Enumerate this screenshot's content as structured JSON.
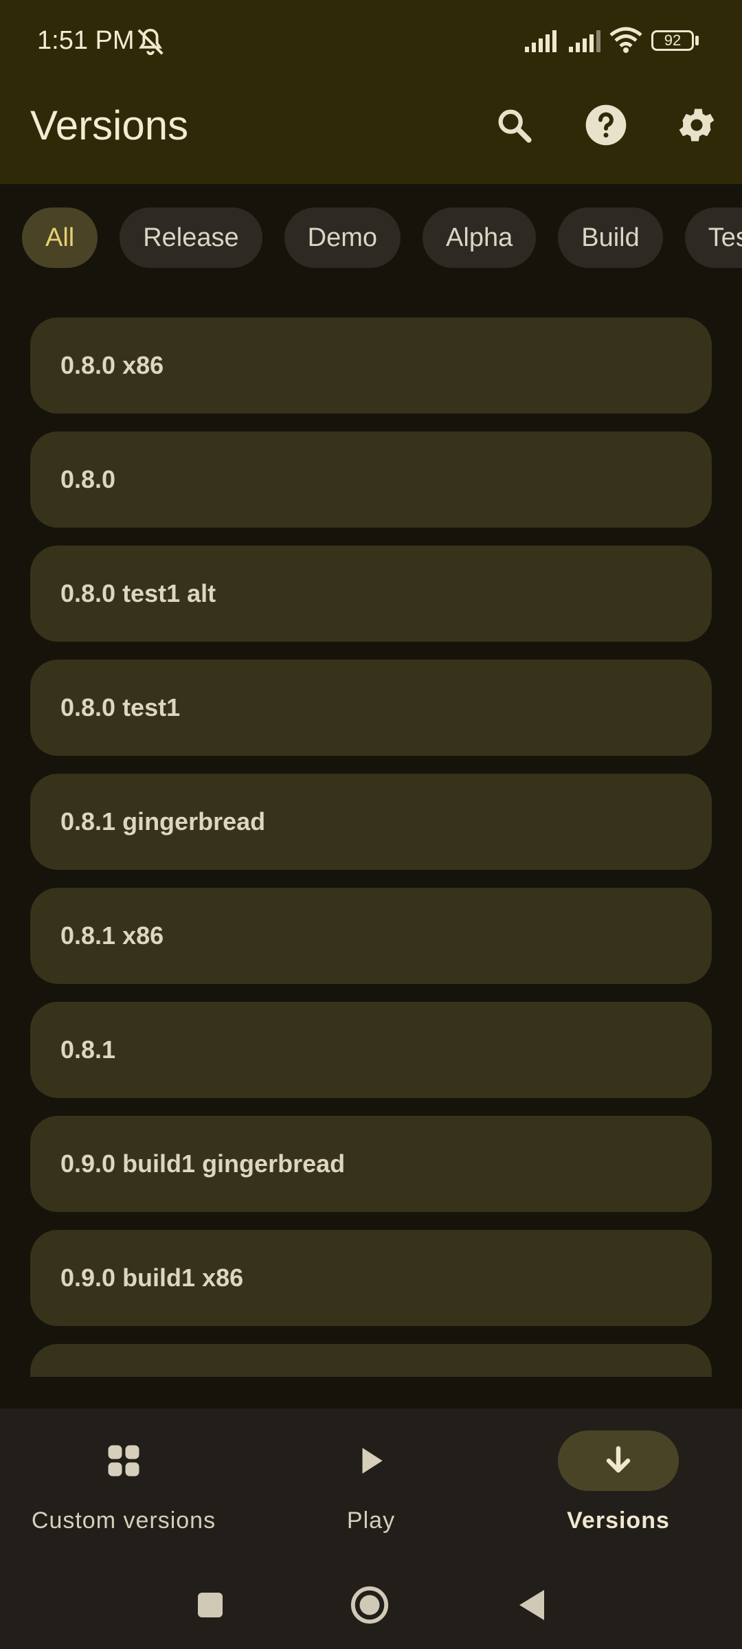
{
  "status_bar": {
    "time": "1:51 PM",
    "battery": "92"
  },
  "app_bar": {
    "title": "Versions",
    "icons": [
      "search-icon",
      "help-icon",
      "settings-icon"
    ]
  },
  "filters": {
    "selected": "All",
    "chips": [
      "All",
      "Release",
      "Demo",
      "Alpha",
      "Build",
      "Test"
    ]
  },
  "versions": [
    "0.8.0 x86",
    "0.8.0",
    "0.8.0 test1 alt",
    "0.8.0 test1",
    "0.8.1 gingerbread",
    "0.8.1 x86",
    "0.8.1",
    "0.9.0 build1 gingerbread",
    "0.9.0 build1 x86",
    ""
  ],
  "bottom_nav": {
    "active": "Versions",
    "items": [
      {
        "label": "Custom versions",
        "icon": "grid-icon"
      },
      {
        "label": "Play",
        "icon": "play-icon"
      },
      {
        "label": "Versions",
        "icon": "download-icon"
      }
    ]
  },
  "colors": {
    "top_bar": "#302907",
    "background": "#16130b",
    "list_item": "#37321a",
    "chip": "#2d2a24",
    "chip_selected": "#4a4325",
    "chip_selected_text": "#e7cf72",
    "bottom_nav": "#221f1a"
  }
}
